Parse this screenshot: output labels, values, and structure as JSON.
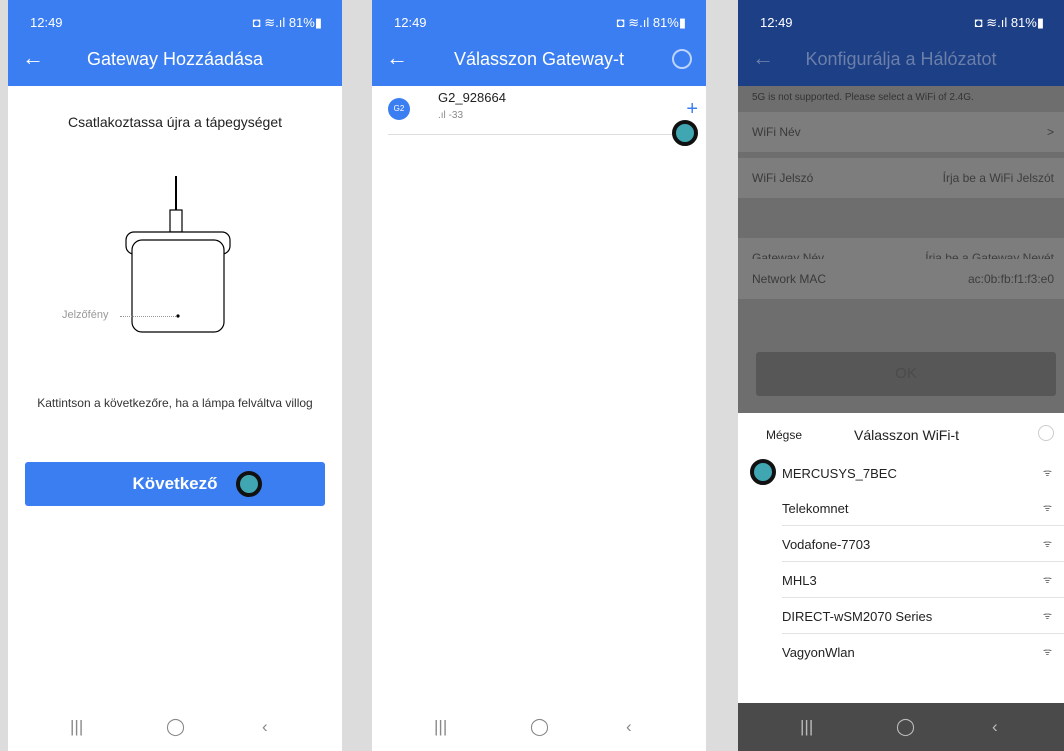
{
  "status": {
    "time": "12:49",
    "icons_left": "▣ ◉ ◉ •",
    "icons_right": "◘ ≋.ıl 81%▮"
  },
  "screen1": {
    "title": "Gateway Hozzáadása",
    "back_icon": "←",
    "instruction_top": "Csatlakoztassa újra a tápegységet",
    "indicator_label": "Jelzőfény",
    "instruction_bottom": "Kattintson a következőre, ha a lámpa felváltva villog",
    "next_button": "Következő"
  },
  "screen2": {
    "title": "Válasszon Gateway-t",
    "back_icon": "←",
    "gateway": {
      "logo": "G2",
      "name": "G2_928664",
      "signal": ".ıl -33",
      "add": "+"
    }
  },
  "screen3": {
    "title": "Konfigurálja a Hálózatot",
    "back_icon": "←",
    "warning": "5G is not supported. Please select a WiFi of 2.4G.",
    "fields": [
      {
        "label": "WiFi Név",
        "value": ">"
      },
      {
        "label": "WiFi Jelszó",
        "value": "Írja be a WiFi Jelszót"
      },
      {
        "label": "Gateway Név",
        "value": "Írja be a Gateway Nevét"
      },
      {
        "label": "Network MAC",
        "value": "ac:0b:fb:f1:f3:e0"
      }
    ],
    "ok_button": "OK",
    "sheet": {
      "cancel": "Mégse",
      "title": "Válasszon WiFi-t",
      "networks": [
        "MERCUSYS_7BEC",
        "Telekomnet",
        "Vodafone-7703",
        "MHL3",
        "DIRECT-wSM2070 Series",
        "VagyonWlan"
      ]
    }
  },
  "nav": {
    "recent": "|||",
    "home": "◯",
    "back": "‹"
  },
  "colors": {
    "header": "#3b7ef1",
    "header_dim": "#1c3f86",
    "marker": "#3fa6b2"
  }
}
